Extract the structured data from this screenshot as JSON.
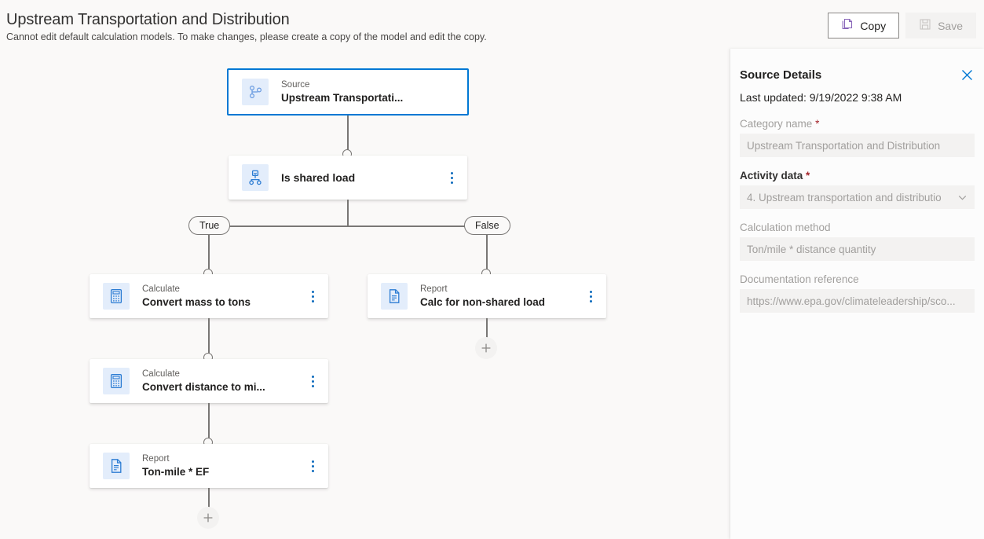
{
  "header": {
    "title": "Upstream Transportation and Distribution",
    "subtitle": "Cannot edit default calculation models. To make changes, please create a copy of the model and edit the copy.",
    "copy_label": "Copy",
    "save_label": "Save",
    "copy_icon": "copy-icon",
    "save_icon": "save-disk-icon"
  },
  "flow": {
    "nodes": [
      {
        "id": "source",
        "type": "Source",
        "title": "Upstream Transportati...",
        "icon": "branch-source-icon",
        "selected": true,
        "has_menu": false
      },
      {
        "id": "condition",
        "type": "",
        "title": "Is shared load",
        "icon": "decision-branch-icon",
        "selected": false,
        "has_menu": true
      },
      {
        "id": "calc1",
        "type": "Calculate",
        "title": "Convert mass to tons",
        "icon": "calculator-icon",
        "selected": false,
        "has_menu": true
      },
      {
        "id": "report1",
        "type": "Report",
        "title": "Calc for non-shared load",
        "icon": "document-report-icon",
        "selected": false,
        "has_menu": true
      },
      {
        "id": "calc2",
        "type": "Calculate",
        "title": "Convert distance to mi...",
        "icon": "calculator-icon",
        "selected": false,
        "has_menu": true
      },
      {
        "id": "report2",
        "type": "Report",
        "title": "Ton-mile * EF",
        "icon": "document-report-icon",
        "selected": false,
        "has_menu": true
      }
    ],
    "branch_true_label": "True",
    "branch_false_label": "False",
    "add_label": "+"
  },
  "panel": {
    "title": "Source Details",
    "close_icon": "close-icon",
    "last_updated": "Last updated: 9/19/2022 9:38 AM",
    "fields": [
      {
        "label": "Category name",
        "required": true,
        "value": "Upstream Transportation and Distribution",
        "type": "text"
      },
      {
        "label": "Activity data",
        "required": true,
        "value": "4. Upstream transportation and distributio",
        "type": "dropdown"
      },
      {
        "label": "Calculation method",
        "required": false,
        "value": "Ton/mile * distance quantity",
        "type": "text"
      },
      {
        "label": "Documentation reference",
        "required": false,
        "value": "https://www.epa.gov/climateleadership/sco...",
        "type": "text"
      }
    ]
  },
  "colors": {
    "accent": "#0078d4",
    "node_icon_blue": "#2b7cd3",
    "copy_icon": "#8764b8",
    "required_asterisk": "#a4262c",
    "connector": "#797775"
  }
}
